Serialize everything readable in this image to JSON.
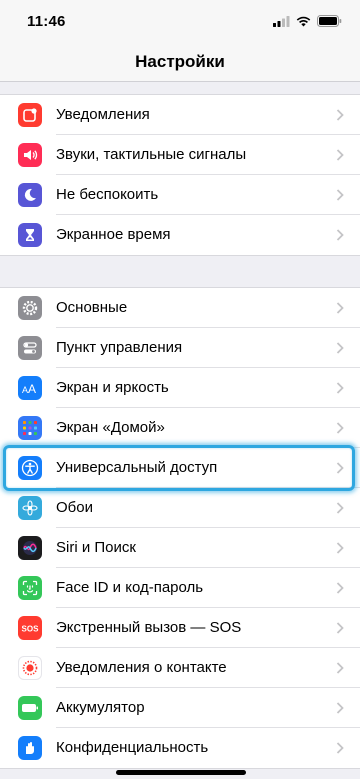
{
  "status": {
    "time": "11:46"
  },
  "nav": {
    "title": "Настройки"
  },
  "groups": [
    {
      "items": [
        {
          "label": "Уведомления",
          "icon": "notifications-icon",
          "color": "#ff3b30"
        },
        {
          "label": "Звуки, тактильные сигналы",
          "icon": "sounds-icon",
          "color": "#ff2d55"
        },
        {
          "label": "Не беспокоить",
          "icon": "do-not-disturb-icon",
          "color": "#5856d6"
        },
        {
          "label": "Экранное время",
          "icon": "screen-time-icon",
          "color": "#5856d6"
        }
      ]
    },
    {
      "items": [
        {
          "label": "Основные",
          "icon": "gear-icon",
          "color": "#8e8e93"
        },
        {
          "label": "Пункт управления",
          "icon": "control-center-icon",
          "color": "#8e8e93"
        },
        {
          "label": "Экран и яркость",
          "icon": "display-brightness-icon",
          "color": "#147efb"
        },
        {
          "label": "Экран «Домой»",
          "icon": "home-screen-icon",
          "color": "#3478f6"
        },
        {
          "label": "Универсальный доступ",
          "icon": "accessibility-icon",
          "color": "#147efb"
        },
        {
          "label": "Обои",
          "icon": "wallpaper-icon",
          "color": "#34aadc"
        },
        {
          "label": "Siri и Поиск",
          "icon": "siri-icon",
          "color": "#1c1c1e"
        },
        {
          "label": "Face ID и код-пароль",
          "icon": "face-id-icon",
          "color": "#34c759"
        },
        {
          "label": "Экстренный вызов — SOS",
          "icon": "sos-icon",
          "color": "#ff3b30"
        },
        {
          "label": "Уведомления о контакте",
          "icon": "exposure-notifications-icon",
          "color": "#ffffff"
        },
        {
          "label": "Аккумулятор",
          "icon": "battery-icon",
          "color": "#34c759"
        },
        {
          "label": "Конфиденциальность",
          "icon": "privacy-icon",
          "color": "#147efb"
        }
      ]
    }
  ],
  "highlighted_item": "Универсальный доступ",
  "colors": {
    "highlight": "#2ea7e0",
    "background": "#efeff4"
  }
}
